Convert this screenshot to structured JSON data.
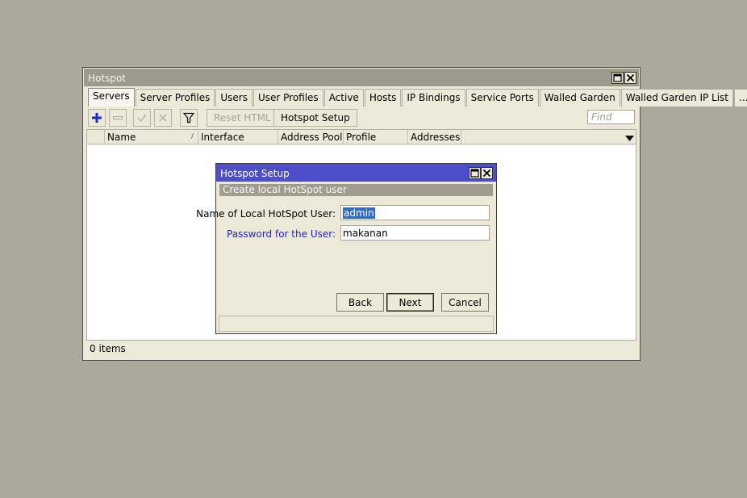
{
  "window": {
    "title": "Hotspot",
    "tabs": [
      "Servers",
      "Server Profiles",
      "Users",
      "User Profiles",
      "Active",
      "Hosts",
      "IP Bindings",
      "Service Ports",
      "Walled Garden",
      "Walled Garden IP List",
      "..."
    ],
    "active_tab": "Servers",
    "toolbar": {
      "reset_html": "Reset HTML",
      "hotspot_setup": "Hotspot Setup",
      "find_placeholder": "Find"
    },
    "columns": [
      "Name",
      "Interface",
      "Address Pool",
      "Profile",
      "Addresses ..."
    ],
    "status": "0 items"
  },
  "dialog": {
    "title": "Hotspot Setup",
    "section": "Create local HotSpot user",
    "fields": [
      {
        "label": "Name of Local HotSpot User:",
        "value": "admin"
      },
      {
        "label": "Password for the User:",
        "value": "makanan"
      }
    ],
    "buttons": {
      "back": "Back",
      "next": "Next",
      "cancel": "Cancel"
    }
  },
  "colors": {
    "desktop": "#aba99b",
    "window_bg": "#ece9d8",
    "dialog_title": "#4e4ec8",
    "accent_blue": "#1d1de0"
  }
}
